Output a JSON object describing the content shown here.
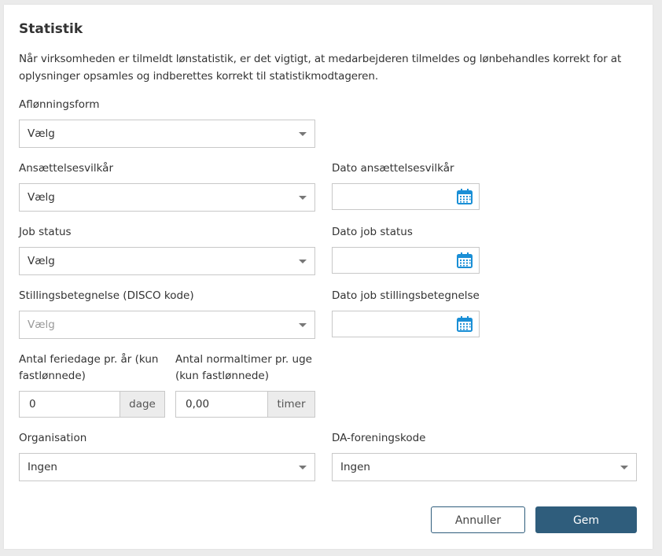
{
  "title": "Statistik",
  "description": "Når virksomheden er tilmeldt lønstatistik, er det vigtigt, at medarbejderen tilmeldes og lønbehandles korrekt for at oplysninger opsamles og indberettes korrekt til statistikmodtageren.",
  "fields": {
    "afloenningsform": {
      "label": "Aflønningsform",
      "value": "Vælg"
    },
    "ansaettelsesvilkaar": {
      "label": "Ansættelsesvilkår",
      "value": "Vælg"
    },
    "dato_ansaettelsesvilkaar": {
      "label": "Dato ansættelsesvilkår",
      "value": ""
    },
    "job_status": {
      "label": "Job status",
      "value": "Vælg"
    },
    "dato_job_status": {
      "label": "Dato job status",
      "value": ""
    },
    "stillingsbetegnelse": {
      "label": "Stillingsbetegnelse (DISCO kode)",
      "value": "Vælg"
    },
    "dato_stillingsbetegnelse": {
      "label": "Dato job stillingsbetegnelse",
      "value": ""
    },
    "feriedage": {
      "label_line1": "Antal feriedage pr. år (kun",
      "label_line2": "fastlønnede)",
      "value": "0",
      "unit": "dage"
    },
    "normaltimer": {
      "label_line1": "Antal normaltimer pr. uge",
      "label_line2": "(kun fastlønnede)",
      "value": "0,00",
      "unit": "timer"
    },
    "organisation": {
      "label": "Organisation",
      "value": "Ingen"
    },
    "da_foreningskode": {
      "label": "DA-foreningskode",
      "value": "Ingen"
    }
  },
  "buttons": {
    "cancel": "Annuller",
    "save": "Gem"
  },
  "icons": {
    "calendar": "calendar-icon",
    "caret": "chevron-down-icon"
  },
  "colors": {
    "primary": "#2f5d7c",
    "calendar_icon": "#1a8fd6",
    "border": "#c8c8c8"
  }
}
